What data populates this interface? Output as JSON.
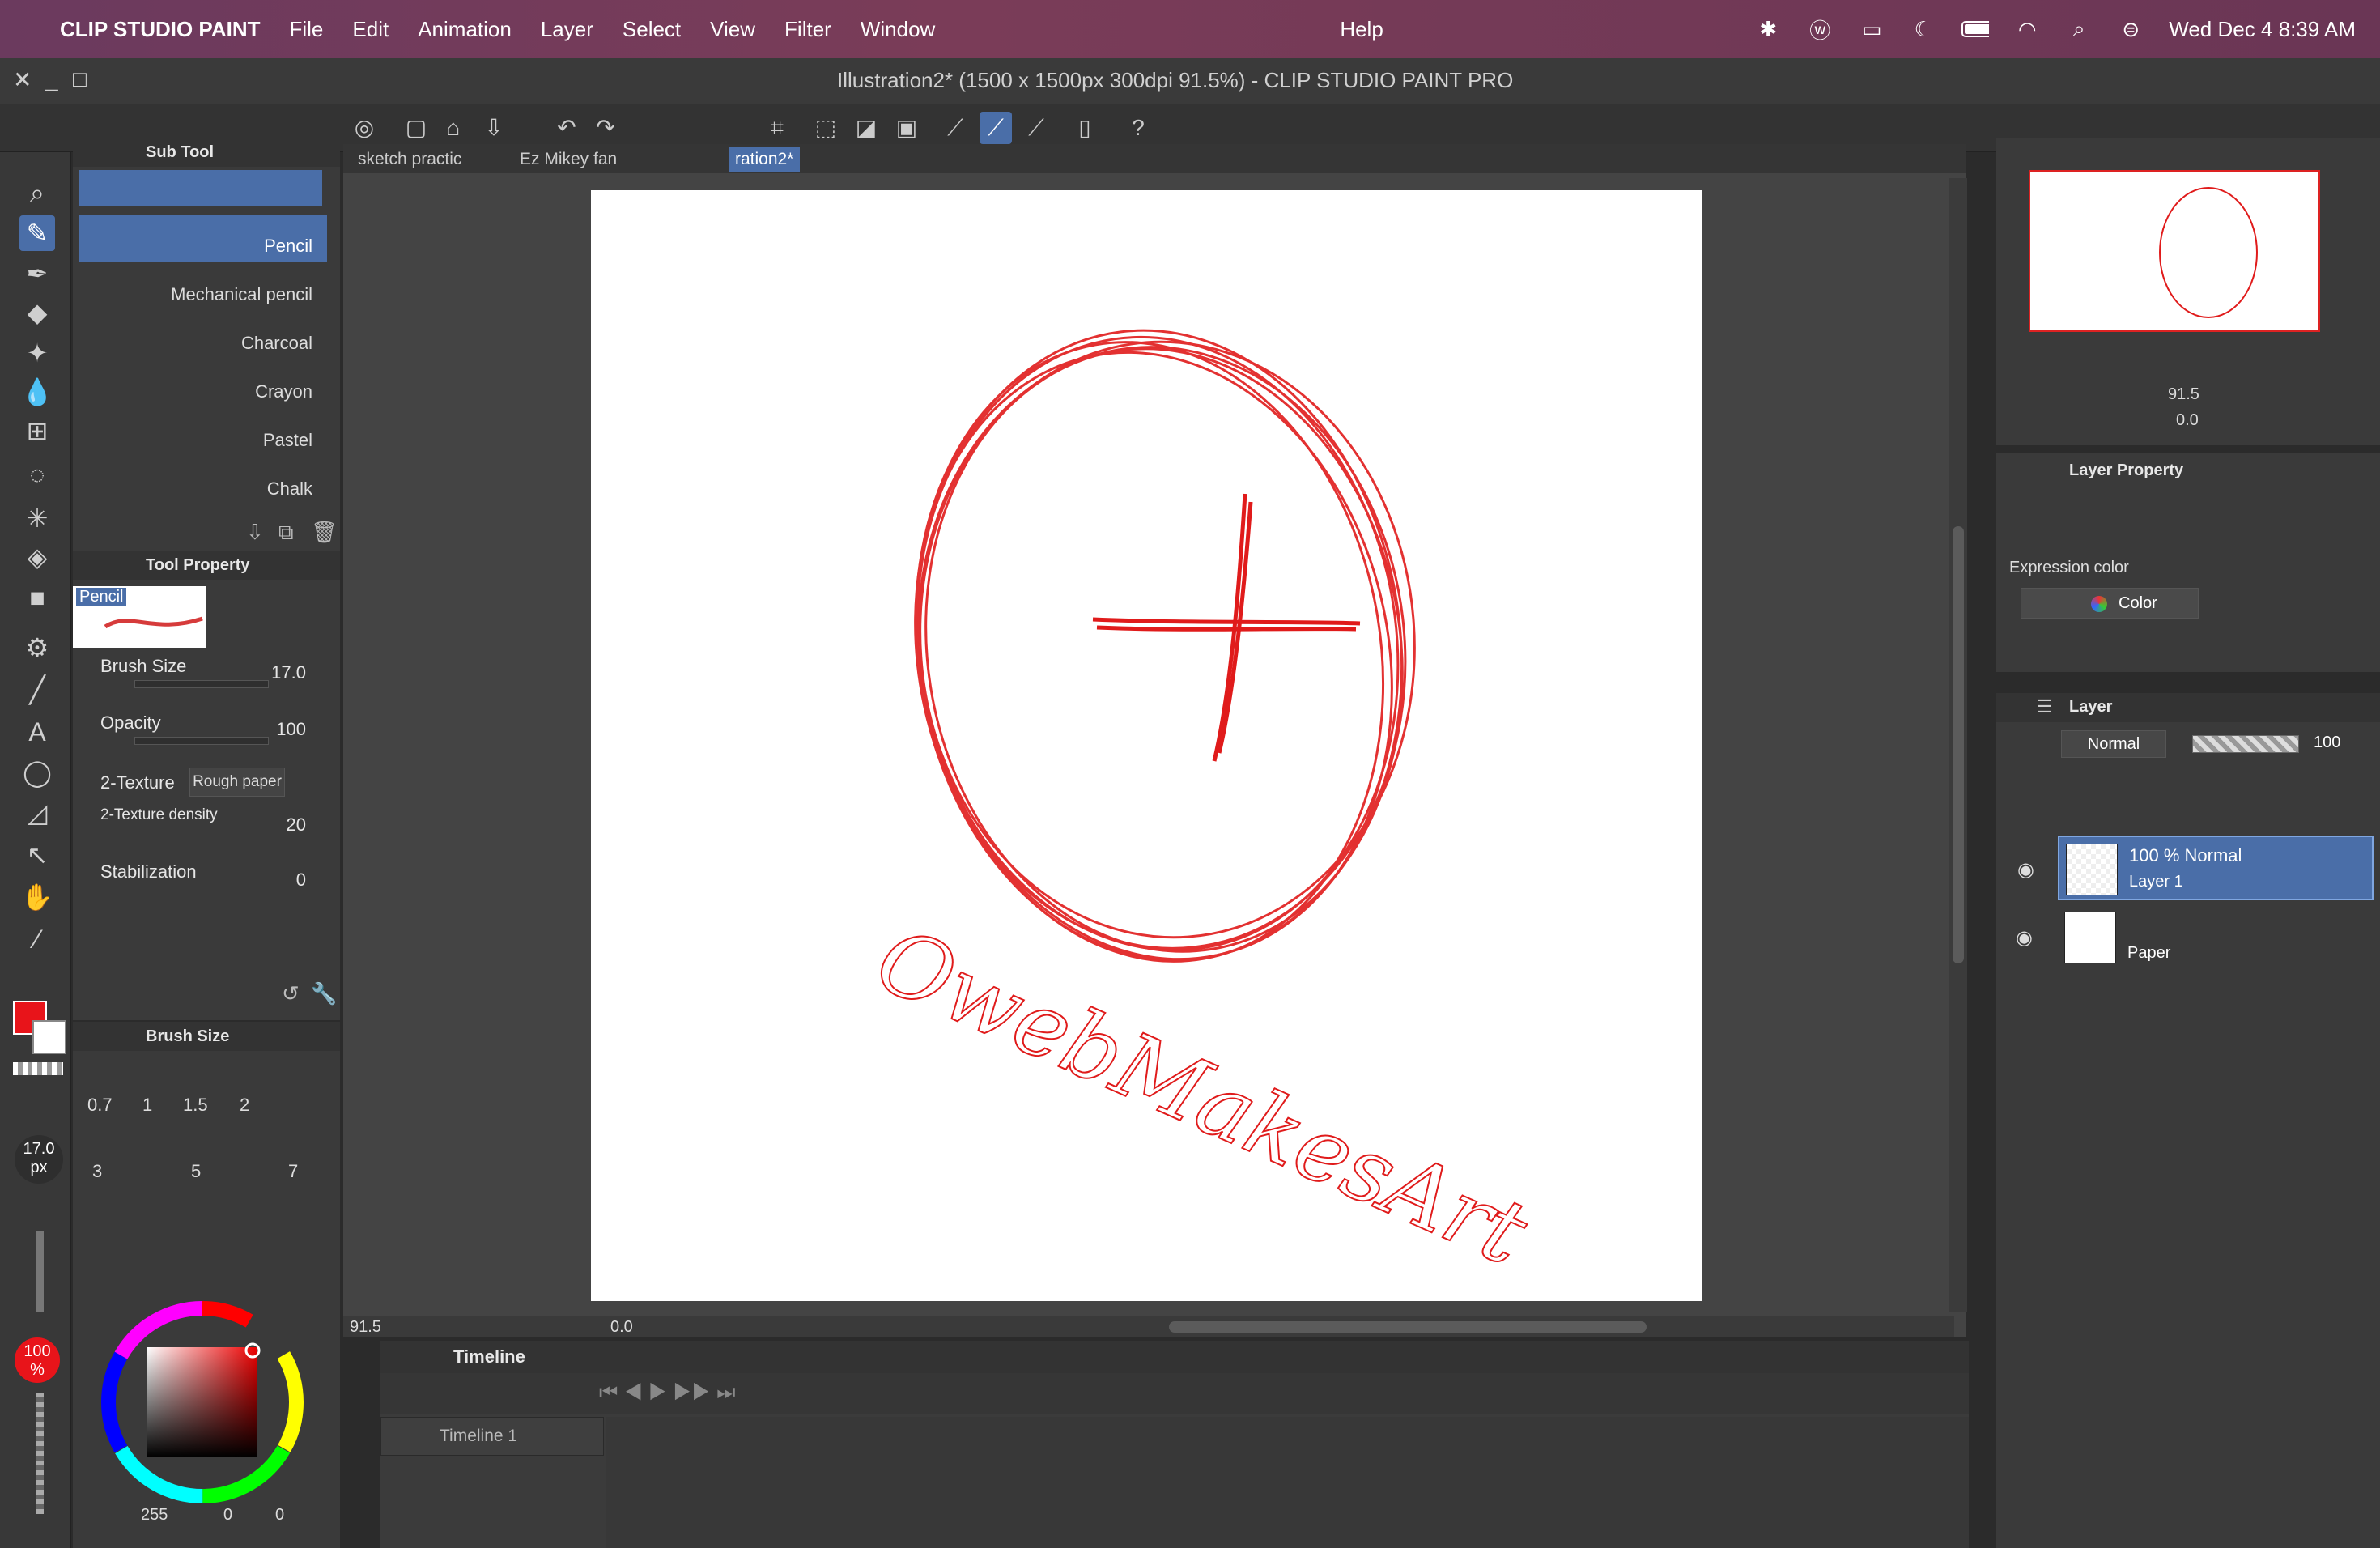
{
  "menubar": {
    "app_name": "CLIP STUDIO PAINT",
    "items": [
      "File",
      "Edit",
      "Animation",
      "Layer",
      "Select",
      "View",
      "Filter",
      "Window",
      "Help"
    ],
    "datetime": "Wed Dec 4  8:39 AM"
  },
  "window": {
    "title": "Illustration2* (1500 x 1500px 300dpi 91.5%)  - CLIP STUDIO PAINT PRO"
  },
  "tabs": [
    {
      "label": "sketch practic"
    },
    {
      "label": "Ez Mikey fan"
    },
    {
      "label": "ration2*"
    }
  ],
  "subtool": {
    "header": "Sub Tool",
    "items": [
      "Pencil",
      "Mechanical pencil",
      "Charcoal",
      "Crayon",
      "Pastel",
      "Chalk"
    ],
    "selected": "Pencil"
  },
  "toolprop": {
    "header": "Tool Property",
    "brush_name": "Pencil",
    "brush_size_label": "Brush Size",
    "brush_size_value": "17.0",
    "opacity_label": "Opacity",
    "opacity_value": "100",
    "texture_label": "2-Texture",
    "texture_value": "Rough paper",
    "density_label": "2-Texture density",
    "density_value": "20",
    "stabilization_label": "Stabilization",
    "stabilization_value": "0"
  },
  "brushsize": {
    "header": "Brush Size",
    "presets": [
      "0.7",
      "1",
      "1.5",
      "2",
      "3",
      "5",
      "7"
    ],
    "current": "17.0",
    "unit": "px",
    "opacity_badge": "100",
    "opacity_unit": "%"
  },
  "color": {
    "main": "#e8141a",
    "sub": "#ffffff",
    "r": "255",
    "g": "0",
    "b": "0"
  },
  "canvas": {
    "zoom": "91.5",
    "angle": "0.0",
    "signature": "OwebMakesArt",
    "stroke_color": "#e01b1b"
  },
  "timeline": {
    "header": "Timeline",
    "name": "Timeline 1"
  },
  "navigator": {
    "zoom": "91.5",
    "angle": "0.0"
  },
  "layerprop": {
    "header": "Layer Property",
    "expression_label": "Expression color",
    "expression_value": "Color"
  },
  "layers": {
    "header": "Layer",
    "blend_mode": "Normal",
    "opacity": "100",
    "items": [
      {
        "line1": "100 %  Normal",
        "line2": "Layer 1"
      },
      {
        "line1": "",
        "line2": "Paper"
      }
    ]
  }
}
